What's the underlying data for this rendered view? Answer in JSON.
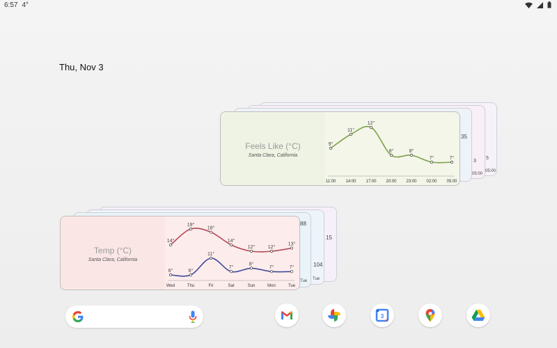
{
  "status_bar": {
    "time": "6:57",
    "temp": "4°"
  },
  "date": "Thu, Nov 3",
  "feels_like_widget": {
    "title": "Feels Like (°C)",
    "location": "Santa Clara, California",
    "peek_values": [
      "35",
      "3",
      "5"
    ],
    "peek_times": [
      "05:00",
      "05:00"
    ],
    "chart_data": {
      "type": "line",
      "title": "Feels Like (°C)",
      "categories": [
        "11:00",
        "14:00",
        "17:00",
        "20:00",
        "23:00",
        "02:00",
        "05:00"
      ],
      "series": [
        {
          "values": [
            9,
            11,
            12,
            8,
            8,
            7,
            7
          ],
          "labels": [
            "9°",
            "11°",
            "12°",
            "8°",
            "8°",
            "7°",
            "7°"
          ]
        }
      ],
      "line_color": "#7ea14a"
    }
  },
  "temp_widget": {
    "title": "Temp (°C)",
    "location": "Santa Clara, California",
    "peek_values": [
      "88",
      "15",
      "104"
    ],
    "peek_days": [
      "Tue",
      "Tue"
    ],
    "chart_data": {
      "type": "line",
      "title": "Temp (°C)",
      "categories": [
        "Wed",
        "Thu",
        "Fri",
        "Sat",
        "Sun",
        "Mon",
        "Tue"
      ],
      "series": [
        {
          "values": [
            14,
            19,
            18,
            14,
            12,
            12,
            13
          ],
          "labels": [
            "14°",
            "19°",
            "18°",
            "14°",
            "12°",
            "12°",
            "13°"
          ],
          "color": "#b44a5a"
        },
        {
          "values": [
            6,
            6,
            11,
            7,
            8,
            7,
            7
          ],
          "labels": [
            "6°",
            "6°",
            "11°",
            "7°",
            "8°",
            "7°",
            "7°"
          ],
          "color": "#3e4a98"
        }
      ]
    }
  },
  "dock": {
    "apps": [
      {
        "name": "Gmail",
        "icon": "gmail-icon"
      },
      {
        "name": "Photos",
        "icon": "photos-icon"
      },
      {
        "name": "Calendar",
        "icon": "calendar-icon",
        "day": "3"
      },
      {
        "name": "Maps",
        "icon": "maps-icon"
      },
      {
        "name": "Drive",
        "icon": "drive-icon"
      }
    ]
  }
}
